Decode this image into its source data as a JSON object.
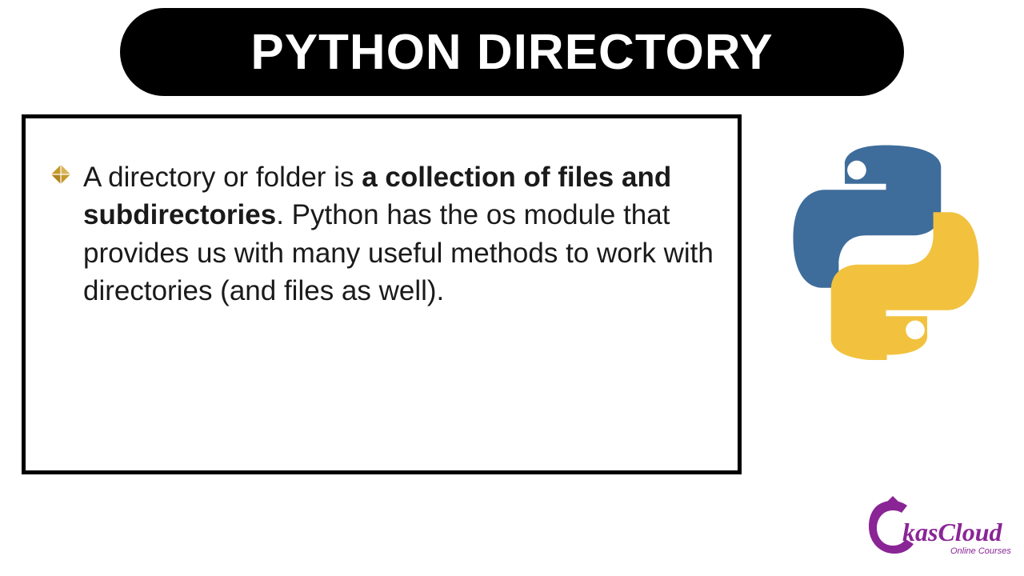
{
  "title": "PYTHON DIRECTORY",
  "body": {
    "lead": "A directory or folder is ",
    "bold": "a collection of files and subdirectories",
    "rest": ". Python has the os module that provides us with many useful methods to work with directories (and files as well)."
  },
  "logo": {
    "name": "kasCloud",
    "sub": "Online Courses"
  },
  "colors": {
    "bullet": "#c59a2c",
    "python_blue": "#3e6d9b",
    "python_yellow": "#f2c23e",
    "brand": "#8a2596"
  }
}
